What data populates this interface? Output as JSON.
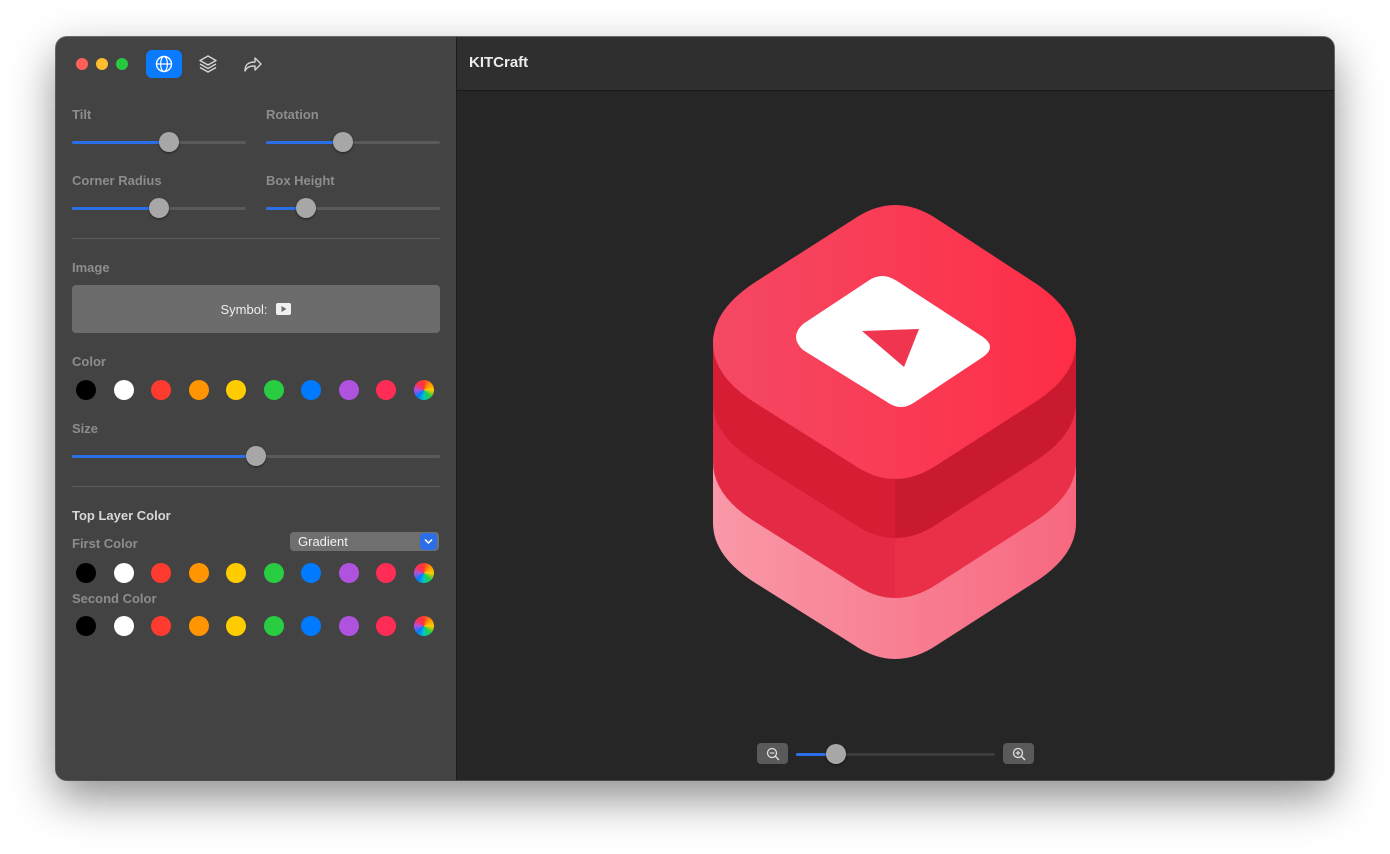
{
  "app": {
    "title": "KITCraft"
  },
  "sliders": {
    "tilt": {
      "label": "Tilt",
      "value": 0.56
    },
    "rotation": {
      "label": "Rotation",
      "value": 0.44
    },
    "corner_radius": {
      "label": "Corner Radius",
      "value": 0.5
    },
    "box_height": {
      "label": "Box Height",
      "value": 0.23
    }
  },
  "image": {
    "section_label": "Image",
    "symbol_label": "Symbol:",
    "color_label": "Color",
    "size_label": "Size",
    "size_value": 0.5
  },
  "top_layer": {
    "title": "Top Layer Color",
    "first_color_label": "First Color",
    "second_color_label": "Second Color",
    "fill_mode": "Gradient"
  },
  "palette": [
    "#000000",
    "#ffffff",
    "#ff3b30",
    "#ff9500",
    "#ffcc00",
    "#28cd41",
    "#007aff",
    "#af52de",
    "#ff2d55",
    "multicolor"
  ],
  "zoom": {
    "value": 0.2
  },
  "accent": "#2b6fe8"
}
